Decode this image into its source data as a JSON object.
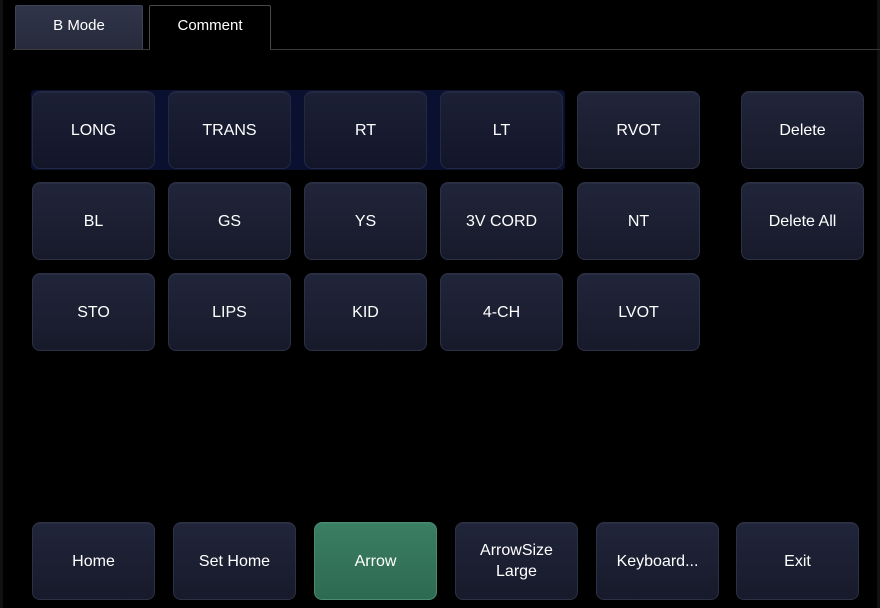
{
  "tabs": [
    {
      "label": "B Mode",
      "active": false
    },
    {
      "label": "Comment",
      "active": true
    }
  ],
  "comments": {
    "row1": [
      "LONG",
      "TRANS",
      "RT",
      "LT",
      "RVOT"
    ],
    "row2": [
      "BL",
      "GS",
      "YS",
      "3V CORD",
      "NT"
    ],
    "row3": [
      "STO",
      "LIPS",
      "KID",
      "4-CH",
      "LVOT"
    ]
  },
  "actions": {
    "delete": "Delete",
    "delete_all": "Delete All"
  },
  "bottom": {
    "home": "Home",
    "set_home": "Set Home",
    "arrow": "Arrow",
    "arrow_size": "ArrowSize\nLarge",
    "keyboard": "Keyboard...",
    "exit": "Exit"
  },
  "colors": {
    "background": "#000000",
    "button": "#1d2133",
    "active_green": "#347359",
    "selection_band": "#0a1030"
  }
}
